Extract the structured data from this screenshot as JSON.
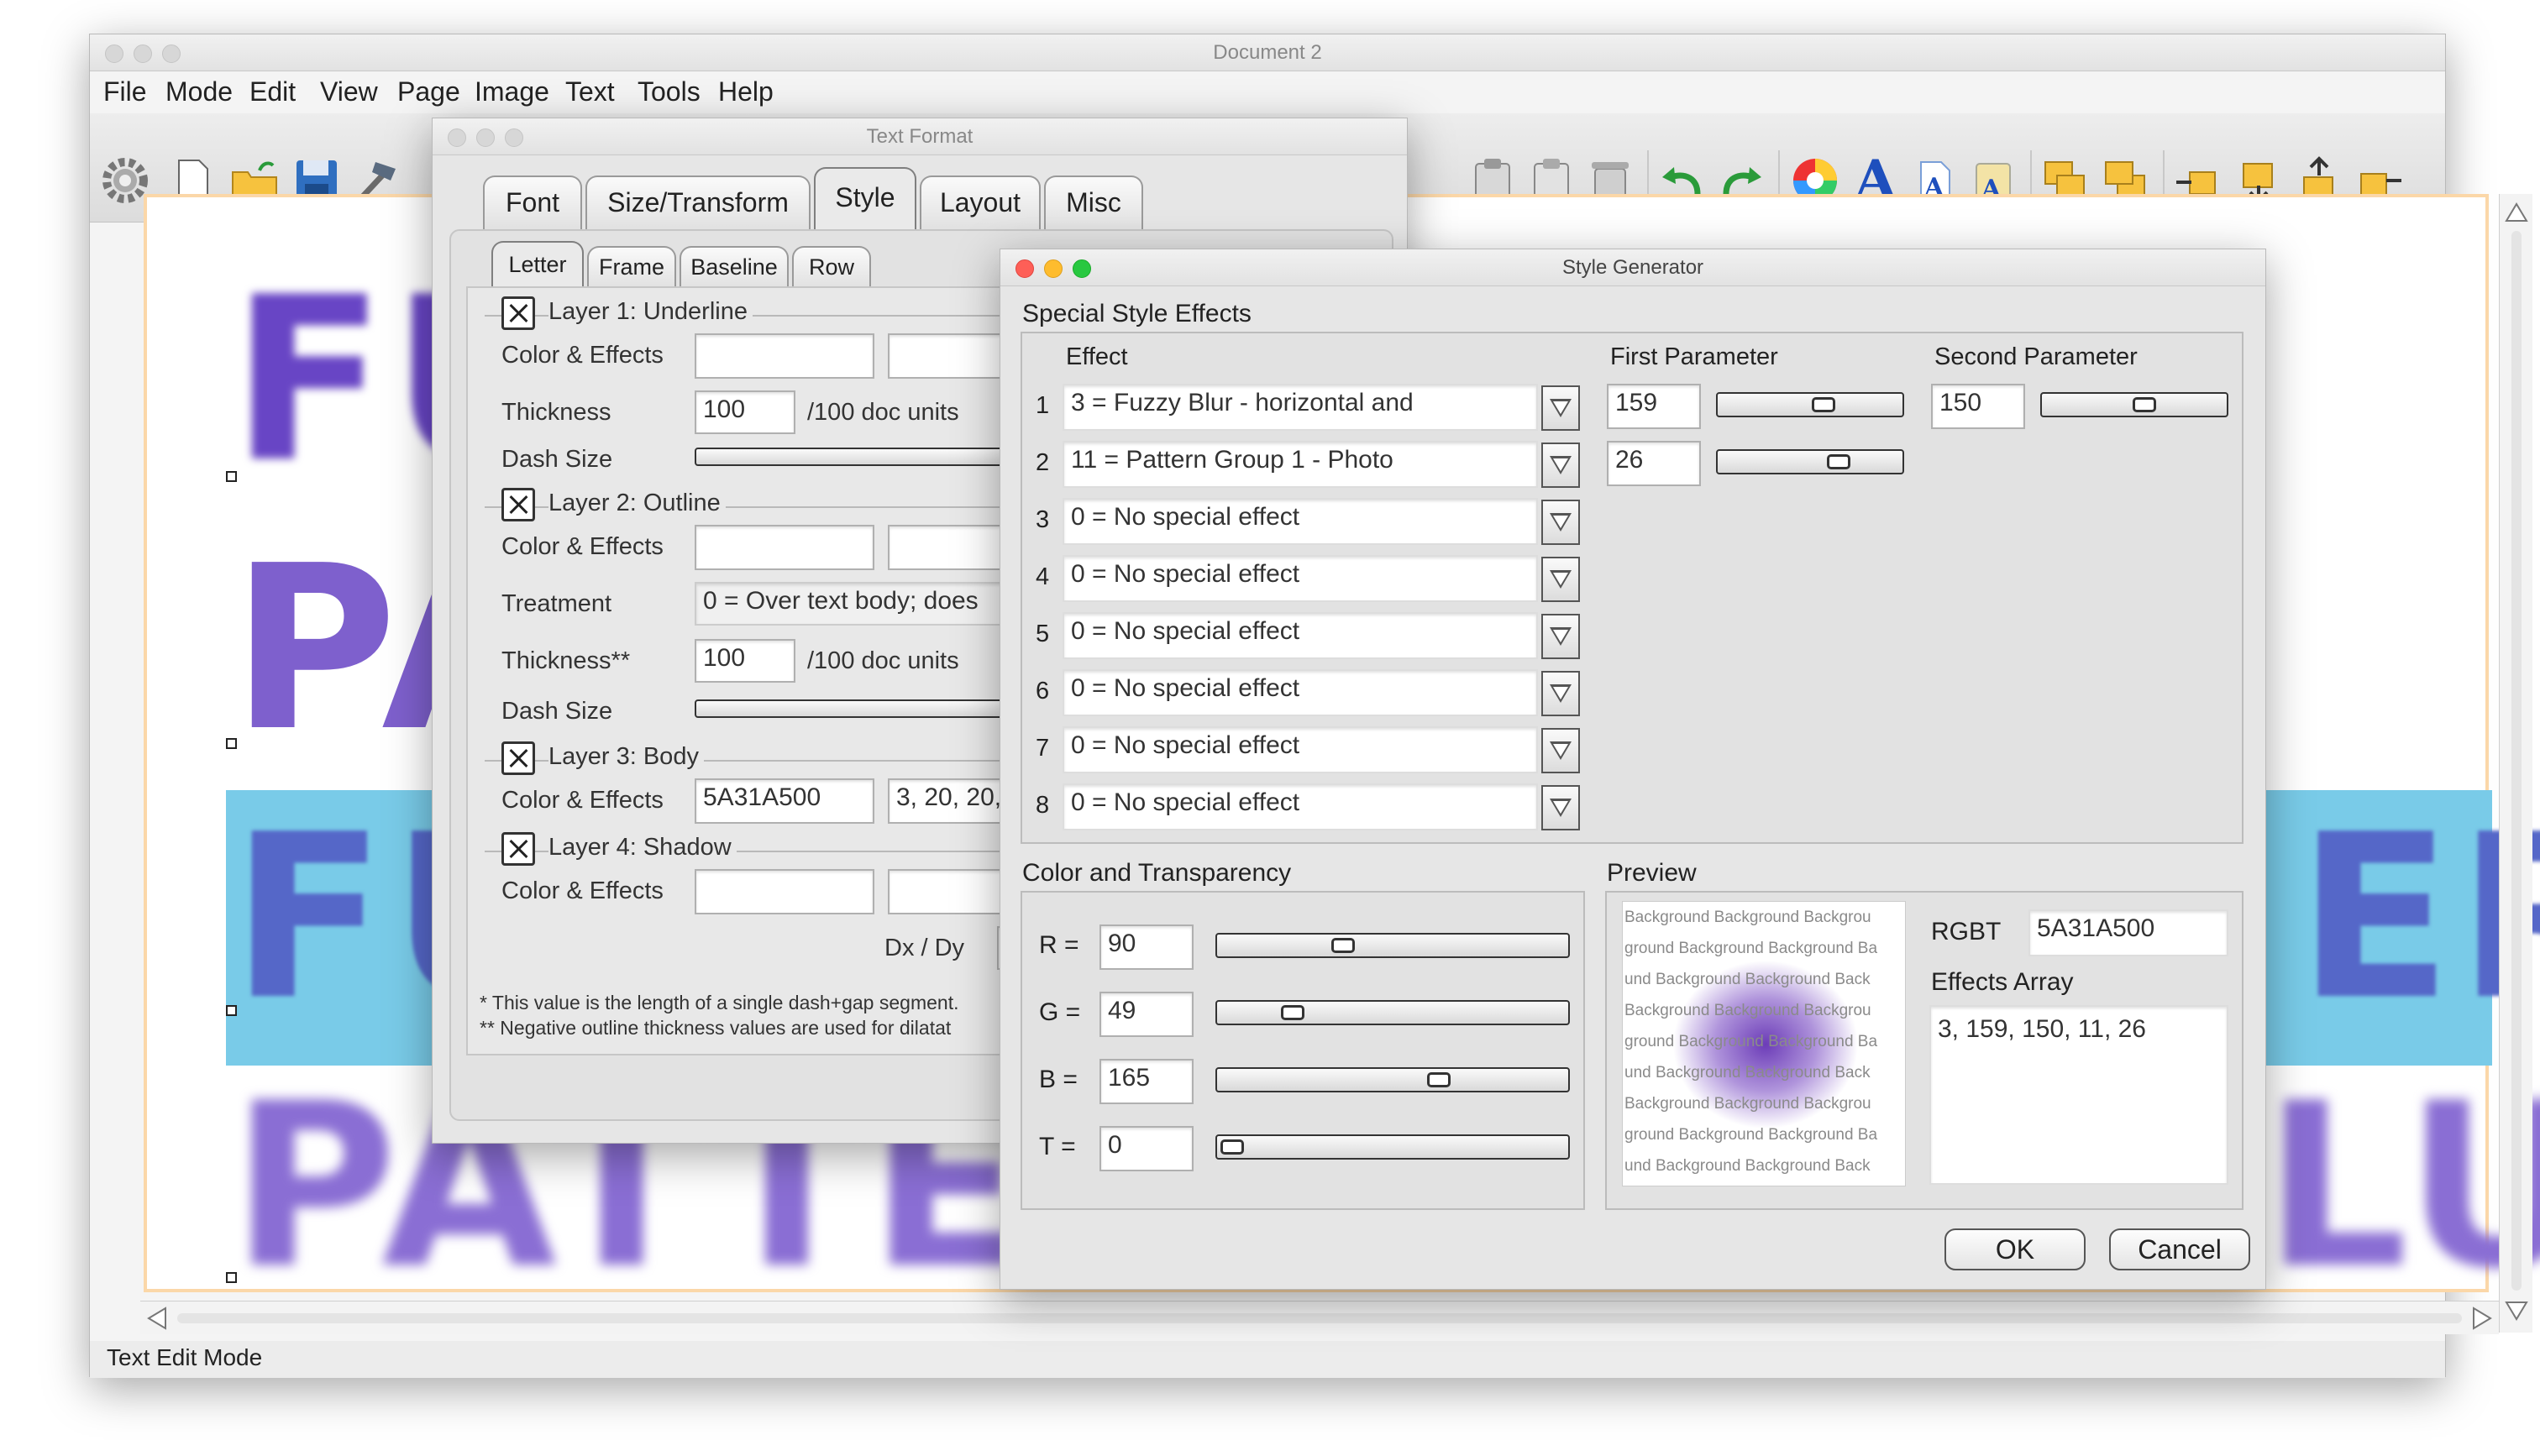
{
  "main_window": {
    "title": "Document 2",
    "menu": [
      "File",
      "Mode",
      "Edit",
      "View",
      "Page",
      "Image",
      "Text",
      "Tools",
      "Help"
    ],
    "status": "Text Edit Mode",
    "canvas_text": [
      "FU",
      "PA",
      "FU",
      "PATTERI",
      "ER",
      "LU"
    ],
    "colors": {
      "text": "#6845c5",
      "highlight": "#79cbe8",
      "page_border": "#fbd7a8"
    }
  },
  "text_format": {
    "title": "Text Format",
    "tabs": [
      "Font",
      "Size/Transform",
      "Style",
      "Layout",
      "Misc"
    ],
    "active_tab": "Style",
    "subtabs": [
      "Letter",
      "Frame",
      "Baseline",
      "Row"
    ],
    "active_subtab": "Letter",
    "layers": {
      "underline": {
        "title": "Layer 1: Underline",
        "color_label": "Color & Effects",
        "thickness_label": "Thickness",
        "thickness": "100",
        "units": "/100 doc units",
        "dash_label": "Dash Size"
      },
      "outline": {
        "title": "Layer 2: Outline",
        "color_label": "Color & Effects",
        "treatment_label": "Treatment",
        "treatment": "0 = Over text body; does",
        "thickness_label": "Thickness**",
        "thickness": "100",
        "units": "/100 doc units",
        "dash_label": "Dash Size"
      },
      "body": {
        "title": "Layer 3: Body",
        "color_label": "Color & Effects",
        "color": "5A31A500",
        "effects": "3, 20, 20,"
      },
      "shadow": {
        "title": "Layer 4: Shadow",
        "color_label": "Color & Effects",
        "dxdy": "Dx / Dy"
      }
    },
    "footnote1": "* This value is the length of a single dash+gap segment.",
    "footnote2": "**  Negative outline thickness values are used for dilatat"
  },
  "style_generator": {
    "title": "Style Generator",
    "section_title": "Special Style Effects",
    "col_effect": "Effect",
    "col_first": "First Parameter",
    "col_second": "Second Parameter",
    "effects": [
      {
        "n": "1",
        "value": "3 = Fuzzy Blur - horizontal and",
        "p1": "159",
        "p1_level": 0.6,
        "p2": "150",
        "p2_level": 0.58
      },
      {
        "n": "2",
        "value": "11 = Pattern Group 1 - Photo",
        "p1": "26",
        "p1_level": 0.7
      },
      {
        "n": "3",
        "value": "0 = No special effect"
      },
      {
        "n": "4",
        "value": "0 = No special effect"
      },
      {
        "n": "5",
        "value": "0 = No special effect"
      },
      {
        "n": "6",
        "value": "0 = No special effect"
      },
      {
        "n": "7",
        "value": "0 = No special effect"
      },
      {
        "n": "8",
        "value": "0 = No special effect"
      }
    ],
    "color_section": "Color and Transparency",
    "channels": [
      {
        "label": "R =",
        "value": "90",
        "level": 0.35
      },
      {
        "label": "G =",
        "value": "49",
        "level": 0.19
      },
      {
        "label": "B =",
        "value": "165",
        "level": 0.65
      },
      {
        "label": "T =",
        "value": "0",
        "level": 0
      }
    ],
    "preview_title": "Preview",
    "preview_lines": [
      "Background Background Backgrou",
      "ground Background Background Ba",
      "und Background Background Back",
      "Background Background Backgrou",
      "ground Background Background Ba",
      "und Background Background Back",
      "Background Background Backgrou",
      "ground Background Background Ba",
      "und Background Background Back"
    ],
    "rgbt_label": "RGBT",
    "rgbt": "5A31A500",
    "effects_array_label": "Effects Array",
    "effects_array": "3, 159, 150, 11, 26",
    "ok": "OK",
    "cancel": "Cancel"
  }
}
